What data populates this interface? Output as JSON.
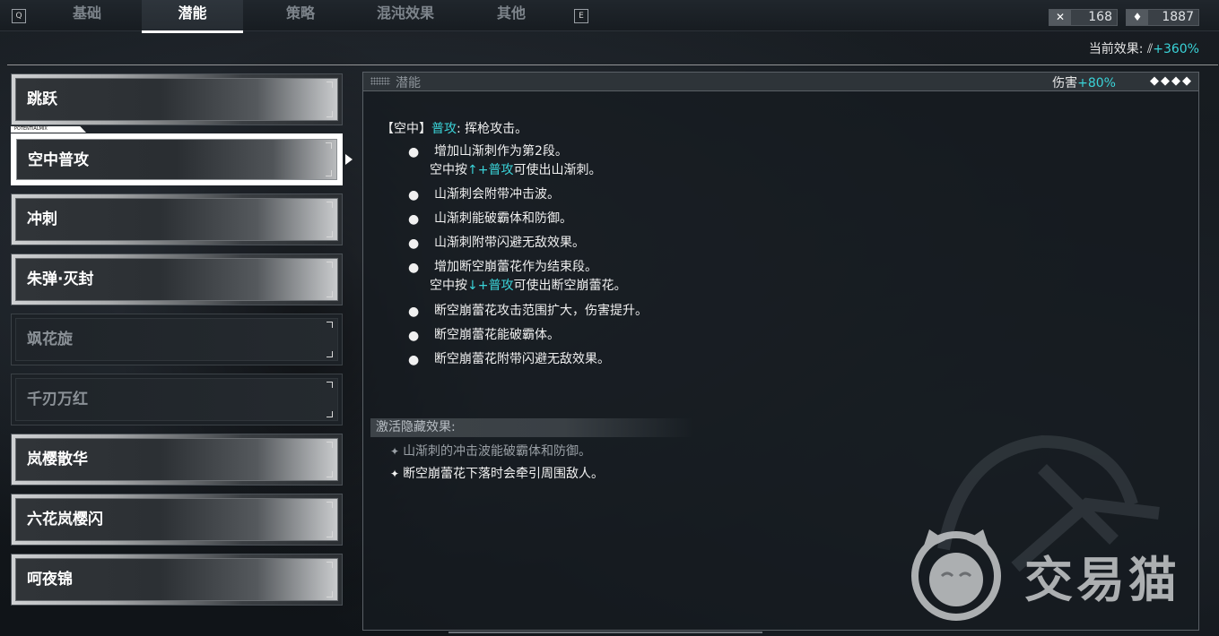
{
  "topbar": {
    "key_left": "Q",
    "key_right": "E",
    "tabs": [
      {
        "label": "基础",
        "active": false
      },
      {
        "label": "潜能",
        "active": true
      },
      {
        "label": "策略",
        "active": false
      },
      {
        "label": "混沌效果",
        "active": false
      },
      {
        "label": "其他",
        "active": false
      }
    ],
    "resources": [
      {
        "icon": "crossed-swords-icon",
        "value": "168"
      },
      {
        "icon": "gem-icon",
        "value": "1887"
      }
    ]
  },
  "current_effect": {
    "label": "当前效果:",
    "value": "+360%",
    "icon": "slash-marks-icon"
  },
  "skill_list": {
    "tag": "POTENTIALMIX",
    "items": [
      {
        "label": "跳跃",
        "state": "normal"
      },
      {
        "label": "空中普攻",
        "state": "selected"
      },
      {
        "label": "冲刺",
        "state": "normal"
      },
      {
        "label": "朱弹·灭封",
        "state": "normal"
      },
      {
        "label": "飒花旋",
        "state": "locked"
      },
      {
        "label": "千刃万红",
        "state": "locked"
      },
      {
        "label": "岚樱散华",
        "state": "normal"
      },
      {
        "label": "六花岚樱闪",
        "state": "normal"
      },
      {
        "label": "呵夜锦",
        "state": "normal"
      }
    ]
  },
  "panel": {
    "title": "潜能",
    "damage_label": "伤害",
    "damage_value": "+80%",
    "diamonds": "◆◆◆◆",
    "desc_prefix": "【空中】",
    "desc_key": "普攻",
    "desc_suffix": ": 挥枪攻击。",
    "bullets": [
      {
        "line1": "增加山渐刺作为第2段。",
        "line2_a": "空中按",
        "line2_key": "↑+普攻",
        "line2_b": "可使出山渐刺。"
      },
      {
        "line1": "山渐刺会附带冲击波。"
      },
      {
        "line1": "山渐刺能破霸体和防御。"
      },
      {
        "line1": "山渐刺附带闪避无敌效果。"
      },
      {
        "line1": "增加断空崩蕾花作为结束段。",
        "line2_a": "空中按",
        "line2_key": "↓+普攻",
        "line2_b": "可使出断空崩蕾花。"
      },
      {
        "line1": "断空崩蕾花攻击范围扩大，伤害提升。"
      },
      {
        "line1": "断空崩蕾花能破霸体。"
      },
      {
        "line1": "断空崩蕾花附带闪避无敌效果。"
      }
    ],
    "hidden_title": "激活隐藏效果:",
    "hidden_effects": [
      {
        "text": "山渐刺的冲击波能破霸体和防御。",
        "active": false
      },
      {
        "text": "断空崩蕾花下落时会牵引周围敌人。",
        "active": true
      }
    ]
  },
  "watermark": {
    "text": "交易猫"
  },
  "colors": {
    "accent_cyan": "#3ad3d8",
    "locked_text": "#8b9197"
  }
}
